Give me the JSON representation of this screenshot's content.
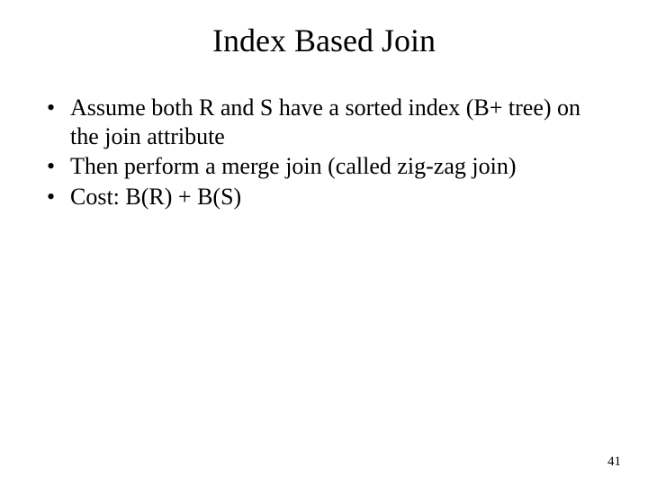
{
  "title": "Index Based Join",
  "bullets": [
    "Assume both R and S have a sorted index (B+ tree) on the join attribute",
    "Then perform a merge join (called zig-zag join)",
    "Cost: B(R) + B(S)"
  ],
  "page_number": "41"
}
